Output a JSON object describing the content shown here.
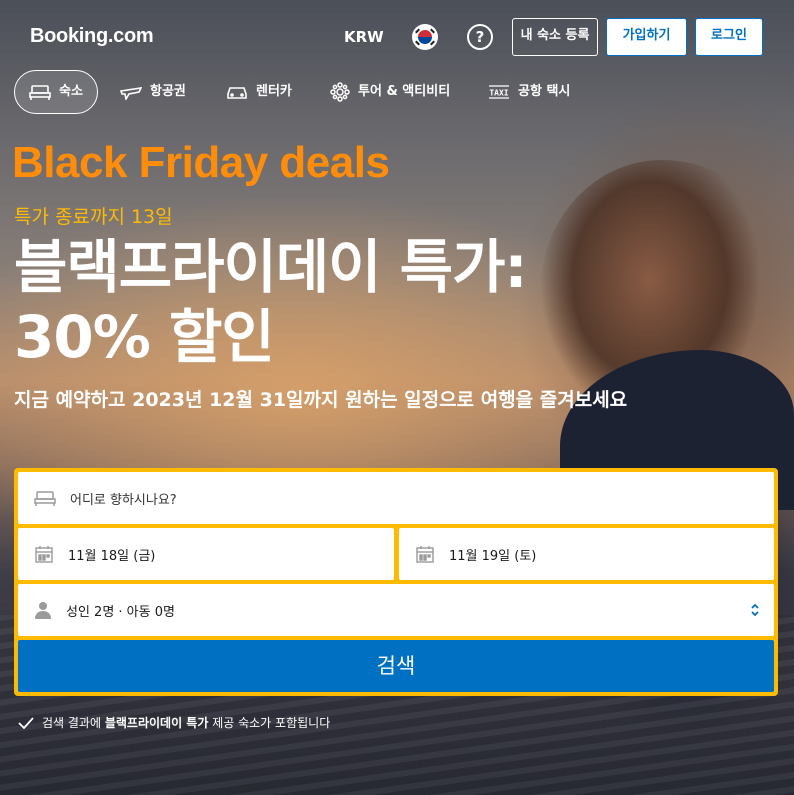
{
  "header": {
    "logo": "Booking.com",
    "currency": "KRW",
    "help_label": "?",
    "list_property": "내 숙소 등록",
    "register": "가입하기",
    "sign_in": "로그인"
  },
  "nav": {
    "items": [
      {
        "label": "숙소",
        "icon": "bed-icon",
        "active": true
      },
      {
        "label": "항공권",
        "icon": "plane-icon",
        "active": false
      },
      {
        "label": "렌터카",
        "icon": "car-icon",
        "active": false
      },
      {
        "label": "투어 & 액티비티",
        "icon": "attractions-icon",
        "active": false
      },
      {
        "label": "공항 택시",
        "icon": "taxi-icon",
        "active": false
      }
    ]
  },
  "hero": {
    "badge": "Black Friday deals",
    "countdown": "특가 종료까지 13일",
    "title": "블랙프라이데이 특가: 30% 할인",
    "subtitle": "지금 예약하고 2023년 12월 31일까지 원하는 일정으로 여행을 즐겨보세요"
  },
  "search": {
    "destination_placeholder": "어디로 향하시나요?",
    "checkin": "11월 18일 (금)",
    "checkout": "11월 19일 (토)",
    "guests": "성인 2명 · 아동 0명",
    "button": "검색"
  },
  "note": {
    "prefix": "검색 결과에 ",
    "bold": "블랙프라이데이 특가",
    "suffix": " 제공 숙소가 포함됩니다"
  },
  "colors": {
    "brand_blue": "#0071c2",
    "accent_yellow": "#febb02",
    "deal_orange": "#ff8d0a"
  }
}
